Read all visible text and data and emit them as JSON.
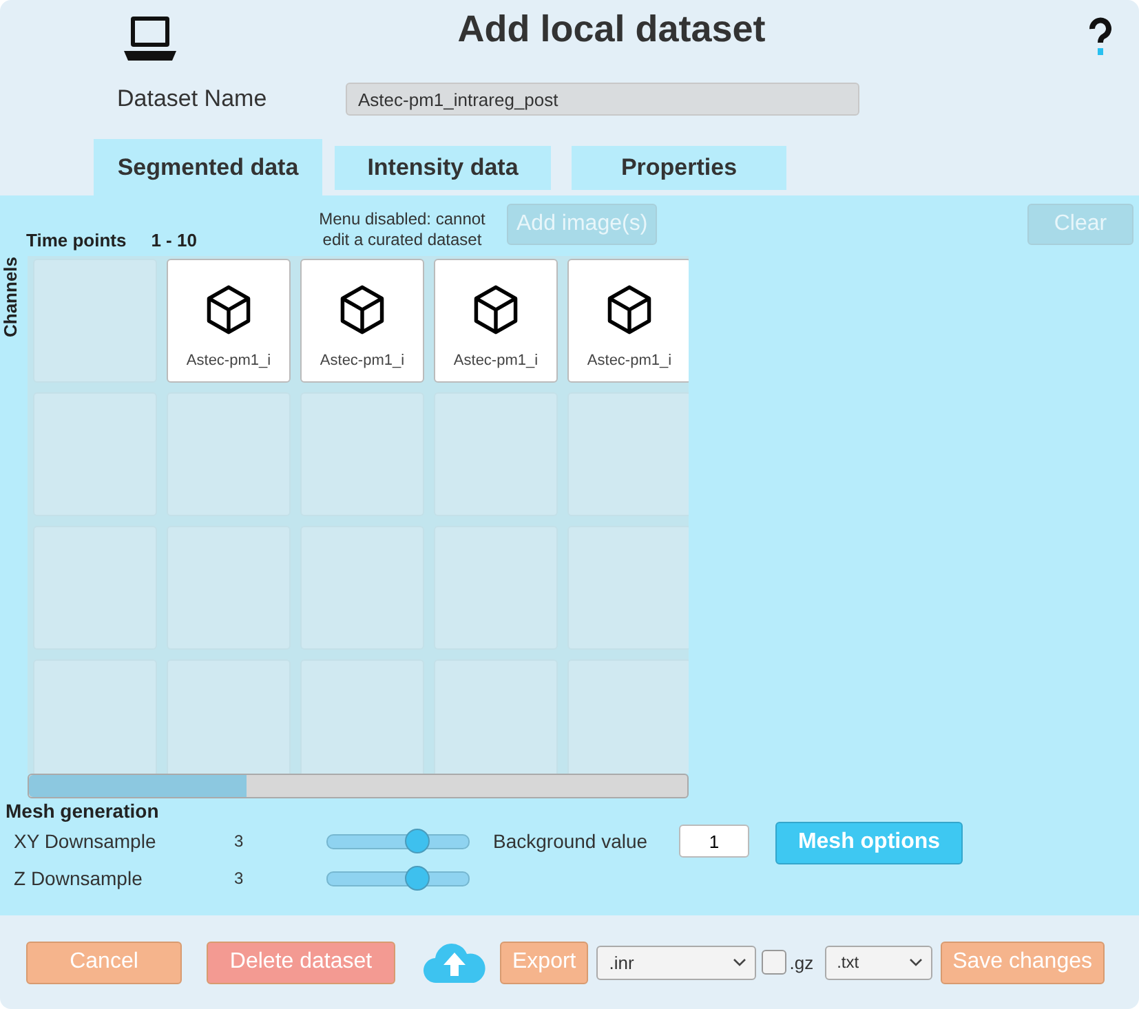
{
  "title": "Add local dataset",
  "dataset_name": {
    "label": "Dataset Name",
    "value": "Astec-pm1_intrareg_post"
  },
  "tabs": [
    {
      "label": "Segmented data",
      "selected": true
    },
    {
      "label": "Intensity data",
      "selected": false
    },
    {
      "label": "Properties",
      "selected": false
    }
  ],
  "time_points": {
    "label": "Time points",
    "range": "1 - 10"
  },
  "channels_label": "Channels",
  "disabled_note": "Menu disabled: cannot edit a curated dataset",
  "add_images": {
    "label": "Add image(s)",
    "disabled": true
  },
  "clear": {
    "label": "Clear",
    "disabled": true
  },
  "grid": [
    [
      {
        "kind": "empty"
      },
      {
        "kind": "file",
        "file": "Astec-pm1_i"
      },
      {
        "kind": "file",
        "file": "Astec-pm1_i"
      },
      {
        "kind": "file",
        "file": "Astec-pm1_i"
      },
      {
        "kind": "file",
        "file": "Astec-pm1_i"
      }
    ],
    [
      {
        "kind": "empty"
      },
      {
        "kind": "empty"
      },
      {
        "kind": "empty"
      },
      {
        "kind": "empty"
      },
      {
        "kind": "empty"
      }
    ],
    [
      {
        "kind": "empty"
      },
      {
        "kind": "empty"
      },
      {
        "kind": "empty"
      },
      {
        "kind": "empty"
      },
      {
        "kind": "empty"
      }
    ],
    [
      {
        "kind": "empty"
      },
      {
        "kind": "empty"
      },
      {
        "kind": "empty"
      },
      {
        "kind": "empty"
      },
      {
        "kind": "empty"
      }
    ]
  ],
  "mesh": {
    "heading": "Mesh generation",
    "sliders": [
      {
        "label": "XY Downsample",
        "value": "3",
        "level": 0.64
      },
      {
        "label": "Z Downsample",
        "value": "3",
        "level": 0.64
      }
    ],
    "background": {
      "label": "Background value",
      "value": "1"
    },
    "options_button": "Mesh options"
  },
  "footer": [
    {
      "kind": "button",
      "label": "Cancel",
      "color": "#f5b48c"
    },
    {
      "kind": "button",
      "label": "Delete dataset",
      "color": "#f39a92"
    },
    {
      "kind": "upload"
    },
    {
      "kind": "button",
      "label": "Export",
      "color": "#f5b48c"
    },
    {
      "kind": "select",
      "value": ".inr"
    },
    {
      "kind": "checkbox",
      "label": ".gz",
      "checked": false
    },
    {
      "kind": "select",
      "value": ".txt"
    },
    {
      "kind": "button",
      "label": "Save changes",
      "color": "#f5b48c"
    }
  ]
}
